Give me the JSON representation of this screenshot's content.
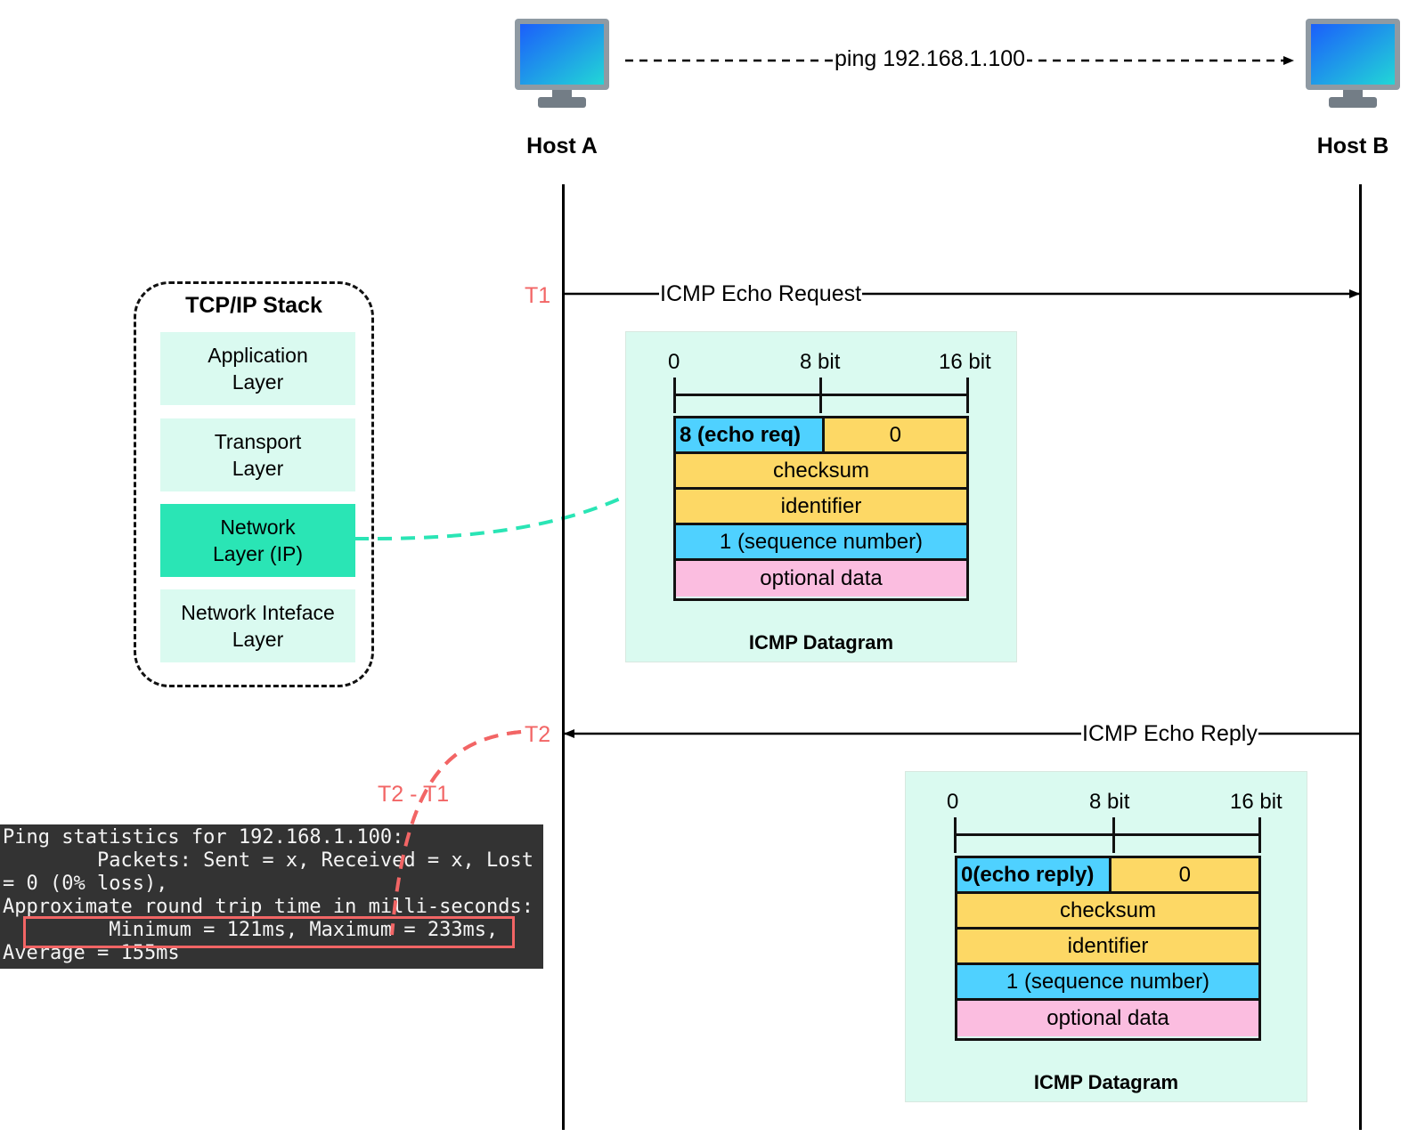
{
  "hosts": {
    "a": {
      "label": "Host A",
      "icon": "desktop-monitor-icon"
    },
    "b": {
      "label": "Host B",
      "icon": "desktop-monitor-icon"
    }
  },
  "ping_command": "ping 192.168.1.100",
  "messages": {
    "request": {
      "label": "ICMP Echo Request",
      "direction": "Host A -> Host B",
      "time_marker": "T1"
    },
    "reply": {
      "label": "ICMP Echo Reply",
      "direction": "Host B -> Host A",
      "time_marker": "T2"
    }
  },
  "rtt_label": "T2 - T1",
  "tcpip_stack": {
    "title": "TCP/IP Stack",
    "layers": [
      {
        "label": "Application Layer",
        "line1": "Application",
        "line2": "Layer",
        "active": false
      },
      {
        "label": "Transport Layer",
        "line1": "Transport",
        "line2": "Layer",
        "active": false
      },
      {
        "label": "Network Layer (IP)",
        "line1": "Network",
        "line2": "Layer (IP)",
        "active": true
      },
      {
        "label": "Network Inteface Layer",
        "line1": "Network Inteface",
        "line2": "Layer",
        "active": false
      }
    ]
  },
  "datagrams": {
    "request": {
      "title": "ICMP Datagram",
      "bit_labels": [
        "0",
        "8 bit",
        "16 bit"
      ],
      "type_field": "8 (echo req)",
      "code_field": "0",
      "checksum": "checksum",
      "identifier": "identifier",
      "sequence": "1 (sequence number)",
      "data": "optional data"
    },
    "reply": {
      "title": "ICMP Datagram",
      "bit_labels": [
        "0",
        "8 bit",
        "16 bit"
      ],
      "type_field": "0(echo reply)",
      "code_field": "0",
      "checksum": "checksum",
      "identifier": "identifier",
      "sequence": "1 (sequence number)",
      "data": "optional data"
    }
  },
  "terminal": {
    "lines": [
      "Ping statistics for 192.168.1.100:",
      "        Packets: Sent = x, Received = x, Lost",
      "= 0 (0% loss),",
      "Approximate round trip time in milli-seconds:",
      "         Minimum = 121ms, Maximum = 233ms,",
      "Average = 155ms"
    ],
    "highlighted_line_index": 4
  },
  "colors": {
    "accent_teal": "#2ae5b5",
    "panel_bg": "#dafaf0",
    "field_yellow": "#fdd865",
    "field_blue": "#4fd1ff",
    "field_pink": "#fbbde0",
    "time_red": "#f26565",
    "terminal_bg": "#333333"
  }
}
